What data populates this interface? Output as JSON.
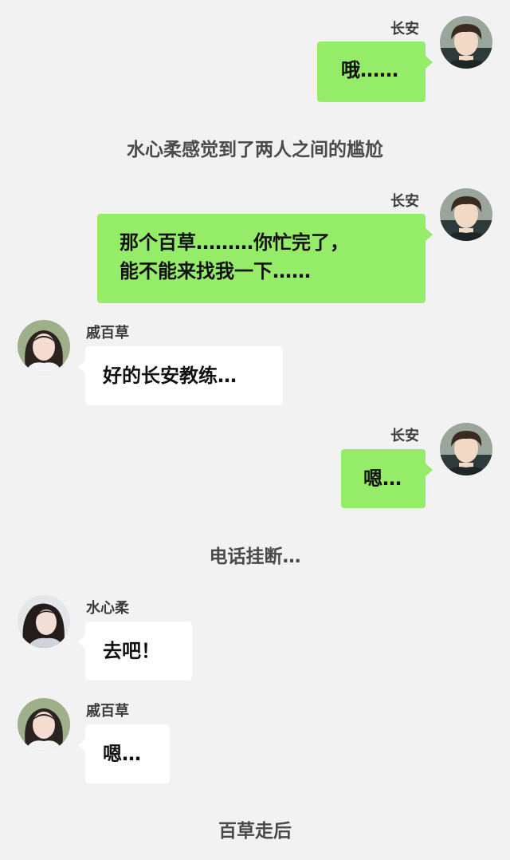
{
  "characters": {
    "changan": "长安",
    "qibaicao": "戚百草",
    "shuixinrou": "水心柔"
  },
  "messages": {
    "m1": "哦……",
    "narration1": "水心柔感觉到了两人之间的尴尬",
    "m2_line1": "那个百草………你忙完了，",
    "m2_line2": "能不能来找我一下……",
    "m3": "好的长安教练…",
    "m4": "嗯…",
    "narration2": "电话挂断…",
    "m5": "去吧！",
    "m6": "嗯…",
    "narration3": "百草走后"
  },
  "colors": {
    "background": "#f2f2f2",
    "outgoing_bubble": "#95ec69",
    "incoming_bubble": "#ffffff"
  },
  "icons": {
    "avatar_changan": "male-avatar-icon",
    "avatar_qibaicao": "female-avatar-icon",
    "avatar_shuixinrou": "female-avatar-icon"
  }
}
